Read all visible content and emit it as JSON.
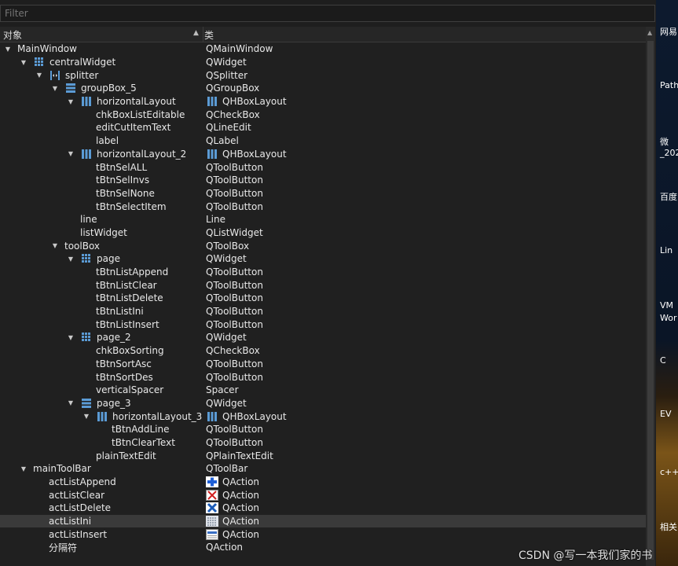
{
  "filter": {
    "placeholder": "Filter",
    "value": ""
  },
  "header": {
    "col_object": "对象",
    "col_class": "类"
  },
  "tree": [
    {
      "name": "MainWindow",
      "cls": "QMainWindow",
      "depth": 0,
      "expand": true,
      "icon": "",
      "cicon": ""
    },
    {
      "name": "centralWidget",
      "cls": "QWidget",
      "depth": 1,
      "expand": true,
      "icon": "grid-layout-icon",
      "cicon": ""
    },
    {
      "name": "splitter",
      "cls": "QSplitter",
      "depth": 2,
      "expand": true,
      "icon": "splitter-icon",
      "cicon": ""
    },
    {
      "name": "groupBox_5",
      "cls": "QGroupBox",
      "depth": 3,
      "expand": true,
      "icon": "vbox-layout-icon",
      "cicon": ""
    },
    {
      "name": "horizontalLayout",
      "cls": "QHBoxLayout",
      "depth": 4,
      "expand": true,
      "icon": "hbox-layout-icon",
      "cicon": "hbox-layout-icon"
    },
    {
      "name": "chkBoxListEditable",
      "cls": "QCheckBox",
      "depth": 5,
      "expand": null,
      "icon": "",
      "cicon": ""
    },
    {
      "name": "editCutItemText",
      "cls": "QLineEdit",
      "depth": 5,
      "expand": null,
      "icon": "",
      "cicon": ""
    },
    {
      "name": "label",
      "cls": "QLabel",
      "depth": 5,
      "expand": null,
      "icon": "",
      "cicon": ""
    },
    {
      "name": "horizontalLayout_2",
      "cls": "QHBoxLayout",
      "depth": 4,
      "expand": true,
      "icon": "hbox-layout-icon",
      "cicon": "hbox-layout-icon"
    },
    {
      "name": "tBtnSelALL",
      "cls": "QToolButton",
      "depth": 5,
      "expand": null,
      "icon": "",
      "cicon": ""
    },
    {
      "name": "tBtnSelInvs",
      "cls": "QToolButton",
      "depth": 5,
      "expand": null,
      "icon": "",
      "cicon": ""
    },
    {
      "name": "tBtnSelNone",
      "cls": "QToolButton",
      "depth": 5,
      "expand": null,
      "icon": "",
      "cicon": ""
    },
    {
      "name": "tBtnSelectItem",
      "cls": "QToolButton",
      "depth": 5,
      "expand": null,
      "icon": "",
      "cicon": ""
    },
    {
      "name": "line",
      "cls": "Line",
      "depth": 4,
      "expand": null,
      "icon": "",
      "cicon": ""
    },
    {
      "name": "listWidget",
      "cls": "QListWidget",
      "depth": 4,
      "expand": null,
      "icon": "",
      "cicon": ""
    },
    {
      "name": "toolBox",
      "cls": "QToolBox",
      "depth": 3,
      "expand": true,
      "icon": "",
      "cicon": ""
    },
    {
      "name": "page",
      "cls": "QWidget",
      "depth": 4,
      "expand": true,
      "icon": "grid-layout-icon",
      "cicon": ""
    },
    {
      "name": "tBtnListAppend",
      "cls": "QToolButton",
      "depth": 5,
      "expand": null,
      "icon": "",
      "cicon": ""
    },
    {
      "name": "tBtnListClear",
      "cls": "QToolButton",
      "depth": 5,
      "expand": null,
      "icon": "",
      "cicon": ""
    },
    {
      "name": "tBtnListDelete",
      "cls": "QToolButton",
      "depth": 5,
      "expand": null,
      "icon": "",
      "cicon": ""
    },
    {
      "name": "tBtnListIni",
      "cls": "QToolButton",
      "depth": 5,
      "expand": null,
      "icon": "",
      "cicon": ""
    },
    {
      "name": "tBtnListInsert",
      "cls": "QToolButton",
      "depth": 5,
      "expand": null,
      "icon": "",
      "cicon": ""
    },
    {
      "name": "page_2",
      "cls": "QWidget",
      "depth": 4,
      "expand": true,
      "icon": "grid-layout-icon",
      "cicon": ""
    },
    {
      "name": "chkBoxSorting",
      "cls": "QCheckBox",
      "depth": 5,
      "expand": null,
      "icon": "",
      "cicon": ""
    },
    {
      "name": "tBtnSortAsc",
      "cls": "QToolButton",
      "depth": 5,
      "expand": null,
      "icon": "",
      "cicon": ""
    },
    {
      "name": "tBtnSortDes",
      "cls": "QToolButton",
      "depth": 5,
      "expand": null,
      "icon": "",
      "cicon": ""
    },
    {
      "name": "verticalSpacer",
      "cls": "Spacer",
      "depth": 5,
      "expand": null,
      "icon": "",
      "cicon": ""
    },
    {
      "name": "page_3",
      "cls": "QWidget",
      "depth": 4,
      "expand": true,
      "icon": "vbox-layout-icon",
      "cicon": ""
    },
    {
      "name": "horizontalLayout_3",
      "cls": "QHBoxLayout",
      "depth": 5,
      "expand": true,
      "icon": "hbox-layout-icon",
      "cicon": "hbox-layout-icon"
    },
    {
      "name": "tBtnAddLine",
      "cls": "QToolButton",
      "depth": 6,
      "expand": null,
      "icon": "",
      "cicon": ""
    },
    {
      "name": "tBtnClearText",
      "cls": "QToolButton",
      "depth": 6,
      "expand": null,
      "icon": "",
      "cicon": ""
    },
    {
      "name": "plainTextEdit",
      "cls": "QPlainTextEdit",
      "depth": 5,
      "expand": null,
      "icon": "",
      "cicon": ""
    },
    {
      "name": "mainToolBar",
      "cls": "QToolBar",
      "depth": 1,
      "expand": true,
      "icon": "",
      "cicon": ""
    },
    {
      "name": "actListAppend",
      "cls": "QAction",
      "depth": 2,
      "expand": null,
      "icon": "",
      "cicon": "plus-icon"
    },
    {
      "name": "actListClear",
      "cls": "QAction",
      "depth": 2,
      "expand": null,
      "icon": "",
      "cicon": "clear-x-icon"
    },
    {
      "name": "actListDelete",
      "cls": "QAction",
      "depth": 2,
      "expand": null,
      "icon": "",
      "cicon": "delete-x-icon"
    },
    {
      "name": "actListIni",
      "cls": "QAction",
      "depth": 2,
      "expand": null,
      "icon": "",
      "cicon": "list-ini-icon",
      "selected": true
    },
    {
      "name": "actListInsert",
      "cls": "QAction",
      "depth": 2,
      "expand": null,
      "icon": "",
      "cicon": "insert-icon"
    },
    {
      "name": "分隔符",
      "cls": "QAction",
      "depth": 2,
      "expand": null,
      "icon": "",
      "cicon": ""
    }
  ],
  "desktop_labels": [
    "网易",
    "Path",
    "微",
    "_202",
    "百度",
    "Lin",
    "VM",
    "Wor",
    "C",
    "EV",
    "c++",
    "相关"
  ],
  "watermark": "CSDN @写一本我们家的书",
  "colors": {
    "background": "#1e1e1e",
    "text": "#e8e8e8",
    "icon_blue": "#5b9bd5",
    "plus_blue": "#1f5fd6",
    "clear_red": "#d02020",
    "delete_blue": "#1a5bb8"
  }
}
